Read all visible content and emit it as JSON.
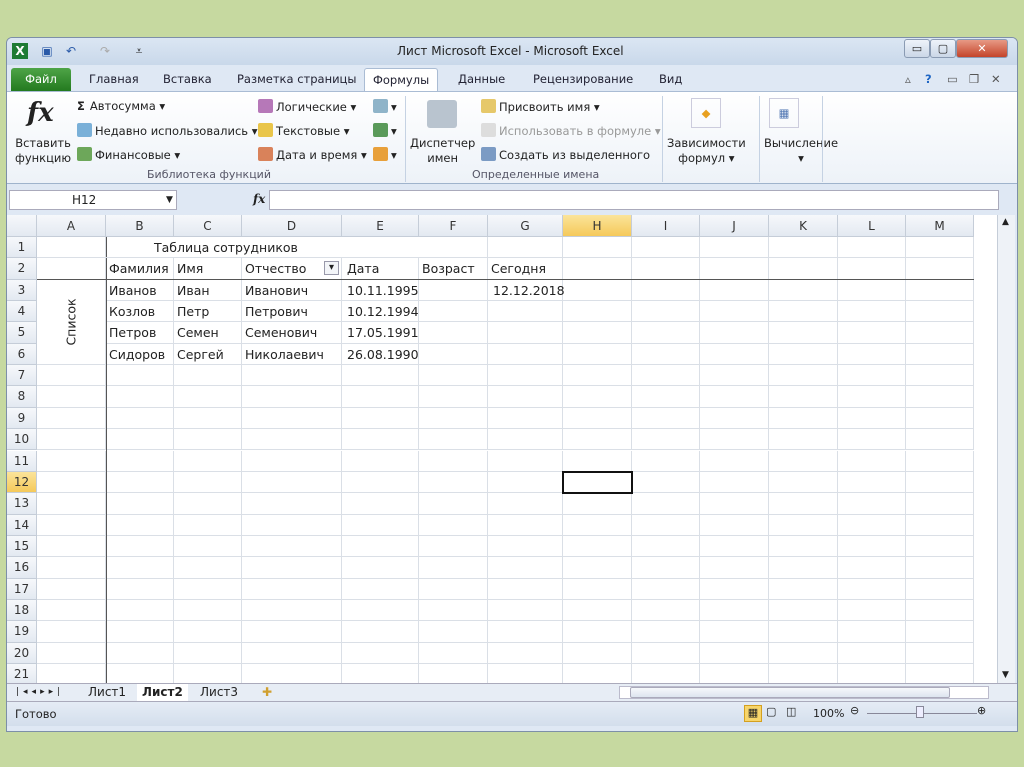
{
  "window": {
    "title": "Лист Microsoft Excel  -  Microsoft Excel"
  },
  "tabs": [
    "Файл",
    "Главная",
    "Вставка",
    "Разметка страницы",
    "Формулы",
    "Данные",
    "Рецензирование",
    "Вид"
  ],
  "active_tab": "Формулы",
  "ribbon": {
    "insert_function": [
      "Вставить",
      "функцию"
    ],
    "autosum": "Автосумма ▾",
    "recent": "Недавно использовались ▾",
    "financial": "Финансовые ▾",
    "logical": "Логические ▾",
    "text": "Текстовые ▾",
    "datetime": "Дата и время ▾",
    "group_library": "Библиотека функций",
    "name_manager": [
      "Диспетчер",
      "имен"
    ],
    "define_name": "Присвоить имя ▾",
    "use_in_formula": "Использовать в формуле ▾",
    "create_from_selection": "Создать из выделенного",
    "group_names": "Определенные имена",
    "auditing": [
      "Зависимости",
      "формул ▾"
    ],
    "calculation": [
      "Вычисление",
      "▾"
    ]
  },
  "formula_bar": {
    "name_box": "H12",
    "fx": "fx",
    "value": ""
  },
  "columns": [
    "A",
    "B",
    "C",
    "D",
    "E",
    "F",
    "G",
    "H",
    "I",
    "J",
    "K",
    "L",
    "M"
  ],
  "selected_cell": {
    "col": "H",
    "row": 12
  },
  "row_count": 21,
  "cells": {
    "B1": "Таблица сотрудников",
    "B2": "Фамилия",
    "C2": "Имя",
    "D2": "Отчество",
    "E2": "Дата",
    "F2": "Возраст",
    "G2": "Сегодня",
    "B3": "Иванов",
    "C3": "Иван",
    "D3": "Иванович",
    "E3": "10.11.1995",
    "G3": "12.12.2018",
    "B4": "Козлов",
    "C4": "Петр",
    "D4": "Петрович",
    "E4": "10.12.1994",
    "B5": "Петров",
    "C5": "Семен",
    "D5": "Семенович",
    "E5": "17.05.1991",
    "B6": "Сидоров",
    "C6": "Сергей",
    "D6": "Николаевич",
    "E6": "26.08.1990"
  },
  "merged_label": "Список",
  "sheets": [
    "Лист1",
    "Лист2",
    "Лист3"
  ],
  "active_sheet": "Лист2",
  "status": {
    "ready": "Готово",
    "zoom": "100%"
  }
}
